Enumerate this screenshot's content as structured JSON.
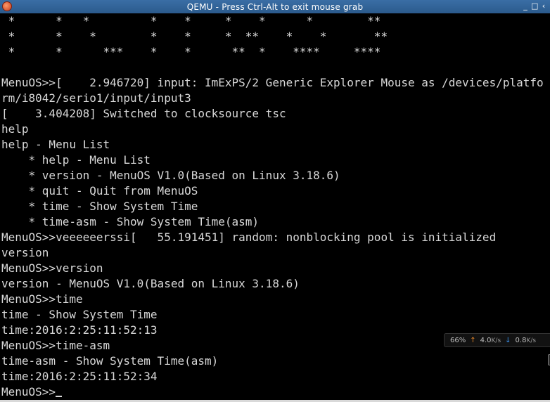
{
  "window": {
    "title": "QEMU - Press Ctrl-Alt to exit mouse grab",
    "controls": [
      "_",
      "□",
      "‹"
    ]
  },
  "terminal": {
    "banner_lines": [
      " *      *   *         *    *     *    *      *        **",
      " *      *    *        *    *     *  **    *    *       **",
      " *      *      ***    *    *      **  *    ****     ****"
    ],
    "lines": [
      "",
      "MenuOS>>[    2.946720] input: ImExPS/2 Generic Explorer Mouse as /devices/platfo",
      "rm/i8042/serio1/input/input3",
      "[    3.404208] Switched to clocksource tsc",
      "help",
      "help - Menu List",
      "    * help - Menu List",
      "    * version - MenuOS V1.0(Based on Linux 3.18.6)",
      "    * quit - Quit from MenuOS",
      "    * time - Show System Time",
      "    * time-asm - Show System Time(asm)",
      "MenuOS>>veeeeeerssi[   55.191451] random: nonblocking pool is initialized",
      "version",
      "MenuOS>>version",
      "version - MenuOS V1.0(Based on Linux 3.18.6)",
      "MenuOS>>time",
      "time - Show System Time",
      "time:2016:2:25:11:52:13",
      "MenuOS>>time-asm",
      "time-asm - Show System Time(asm)",
      "time:2016:2:25:11:52:34"
    ],
    "prompt": "MenuOS>>"
  },
  "netmeter": {
    "percent": "66%",
    "up_arrow": "↑",
    "up_value": "4.0",
    "up_unit": "K/s",
    "down_arrow": "↓",
    "down_value": "0.8",
    "down_unit": "K/s"
  },
  "colors": {
    "titlebar": "#2b5a8c",
    "terminal_bg": "#000000",
    "terminal_fg": "#d8d8d8",
    "upload": "#e8882a",
    "download": "#3a8ee6"
  }
}
